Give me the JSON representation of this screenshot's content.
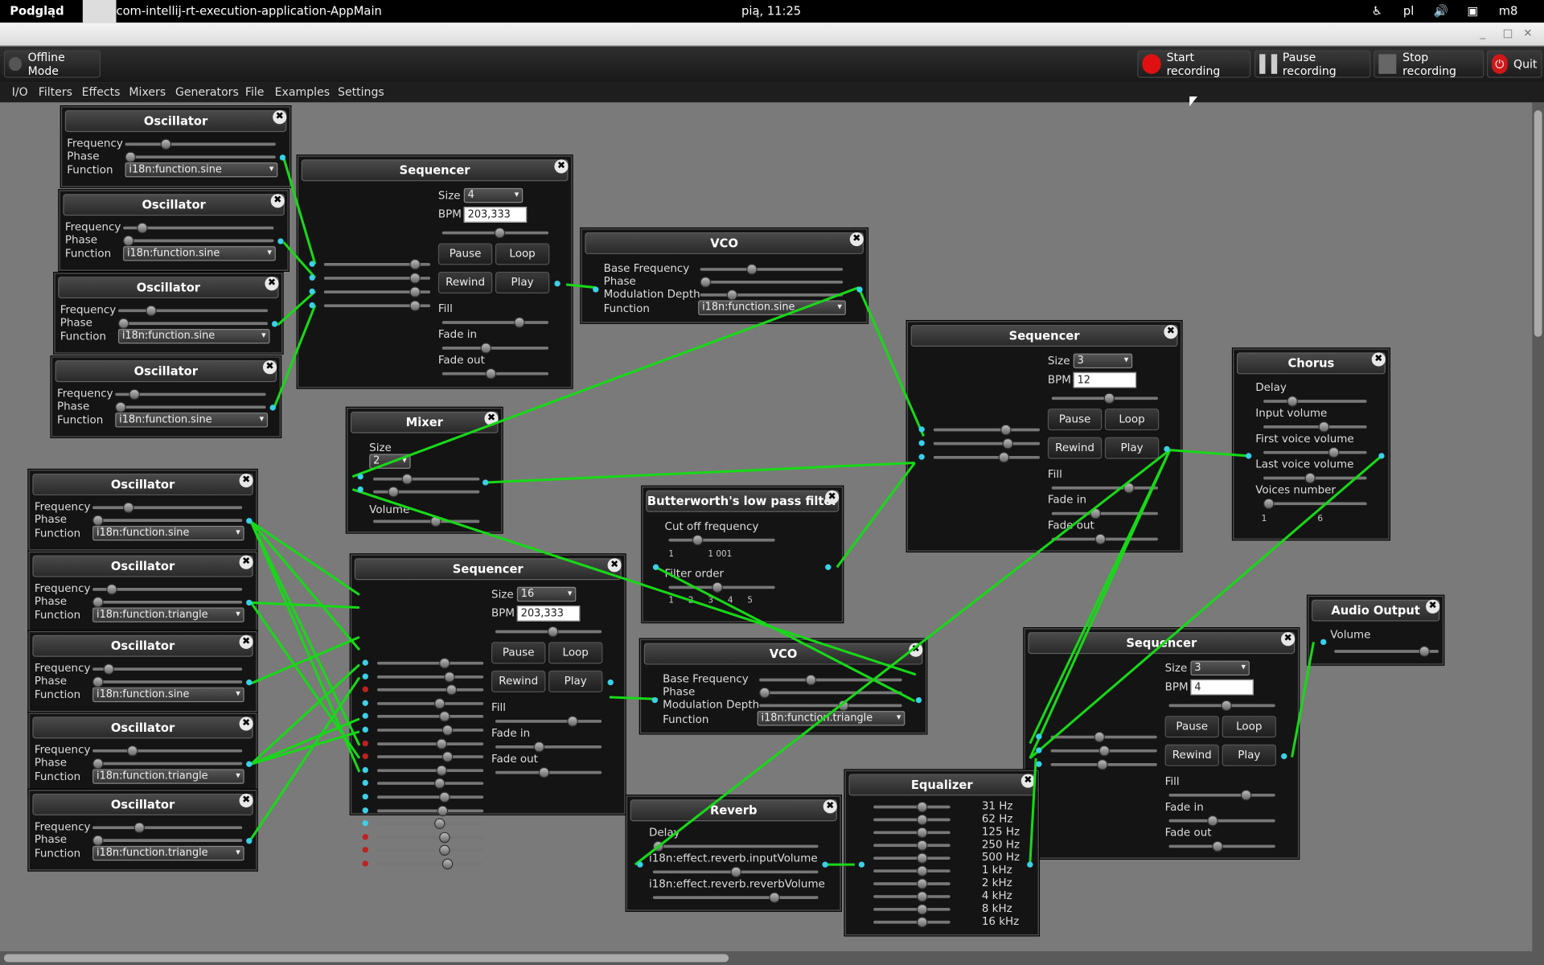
{
  "topbar": {
    "app": "Podgląd",
    "window": "com-intellij-rt-execution-application-AppMain",
    "clock": "pią, 11:25",
    "lang": "pl",
    "user": "m8"
  },
  "toolbar": {
    "offline": "Offline Mode",
    "start": "Start recording",
    "pause": "Pause recording",
    "stop": "Stop recording",
    "quit": "Quit"
  },
  "menu": [
    "I/O",
    "Filters",
    "Effects",
    "Mixers",
    "Generators",
    "File",
    "Examples",
    "Settings"
  ],
  "common": {
    "oscillator": "Oscillator",
    "sequencer": "Sequencer",
    "vco": "VCO",
    "frequency": "Frequency",
    "phase": "Phase",
    "function": "Function",
    "size": "Size",
    "bpm": "BPM",
    "pause": "Pause",
    "loop": "Loop",
    "rewind": "Rewind",
    "play": "Play",
    "fill": "Fill",
    "fade_in": "Fade in",
    "fade_out": "Fade out",
    "base_freq": "Base Frequency",
    "mod_depth": "Modulation Depth",
    "volume": "Volume",
    "fn_sine": "i18n:function.sine",
    "fn_triangle": "i18n:function.triangle"
  },
  "mixer": {
    "title": "Mixer",
    "size": "2"
  },
  "butterworth": {
    "title": "Butterworth's low pass filter",
    "cutoff": "Cut off frequency",
    "order": "Filter order",
    "t1": "1",
    "t2": "1 001",
    "o1": "1",
    "o2": "2",
    "o3": "3",
    "o4": "4",
    "o5": "5"
  },
  "chorus": {
    "title": "Chorus",
    "delay": "Delay",
    "input": "Input volume",
    "first": "First voice volume",
    "last": "Last voice volume",
    "voices": "Voices number",
    "t1": "1",
    "t2": "6"
  },
  "audio": {
    "title": "Audio Output"
  },
  "reverb": {
    "title": "Reverb",
    "delay": "Delay",
    "input": "i18n:effect.reverb.inputVolume",
    "rv": "i18n:effect.reverb.reverbVolume"
  },
  "equalizer": {
    "title": "Equalizer",
    "bands": [
      "31 Hz",
      "62 Hz",
      "125 Hz",
      "250 Hz",
      "500 Hz",
      "1 kHz",
      "2 kHz",
      "4 kHz",
      "8 kHz",
      "16 kHz"
    ]
  },
  "seq1": {
    "size": "4",
    "bpm": "203,333"
  },
  "seq2": {
    "size": "16",
    "bpm": "203,333"
  },
  "seq3": {
    "size": "3",
    "bpm": "12"
  },
  "seq4": {
    "size": "3",
    "bpm": "4"
  }
}
